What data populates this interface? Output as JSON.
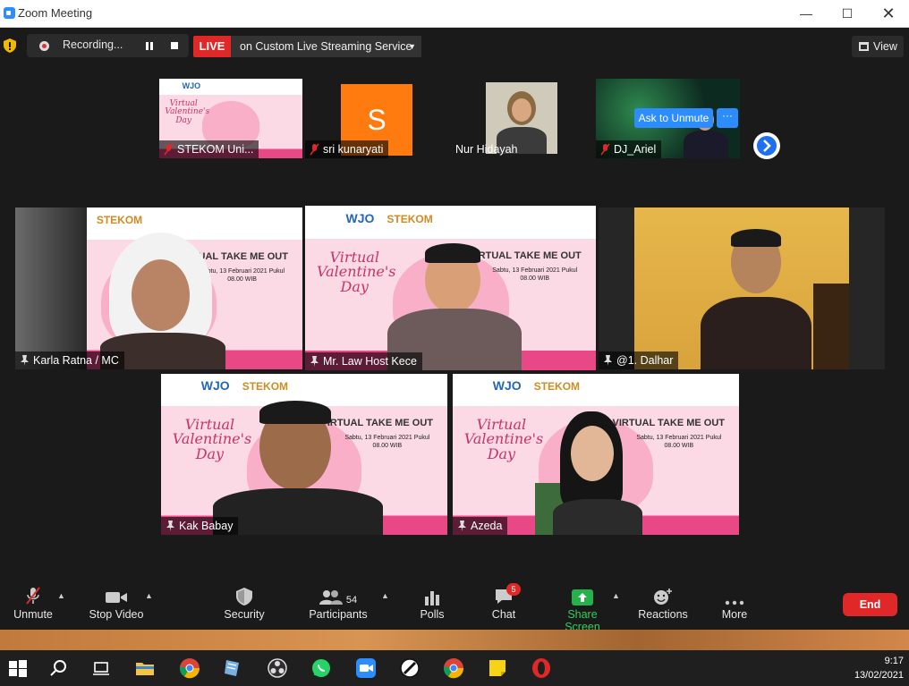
{
  "window": {
    "title": "Zoom Meeting"
  },
  "topbar": {
    "recording_label": "Recording...",
    "live_label": "LIVE",
    "live_service": "on Custom Live Streaming Service",
    "view_label": "View"
  },
  "poster": {
    "logo": "WJO",
    "logo2": "STEKOM",
    "script_title": "Virtual Valentine's Day",
    "headline": "VIRTUAL TAKE ME OUT",
    "info": "Sabtu, 13 Februari 2021 Pukul 08.00 WIB"
  },
  "thumbnails": [
    {
      "name": "STEKOM Uni..."
    },
    {
      "name": "sri kunaryati",
      "initial": "S"
    },
    {
      "name": "Nur Hidayah"
    },
    {
      "name": "DJ_Ariel"
    }
  ],
  "ask_to_unmute": "Ask to Unmute",
  "ask_more": "···",
  "gallery": [
    {
      "name": "Karla Ratna / MC"
    },
    {
      "name": "Mr. Law Host Kece"
    },
    {
      "name": "@1. Dalhar"
    },
    {
      "name": "Kak Babay"
    },
    {
      "name": "Azeda"
    }
  ],
  "toolbar": {
    "unmute": "Unmute",
    "stop_video": "Stop Video",
    "security": "Security",
    "participants": "Participants",
    "participants_count": "54",
    "polls": "Polls",
    "chat": "Chat",
    "chat_badge": "5",
    "share_screen": "Share Screen",
    "reactions": "Reactions",
    "more": "More",
    "end": "End"
  },
  "taskbar": {
    "time": "9:17",
    "date": "13/02/2021"
  },
  "colors": {
    "accent": "#2d8cff",
    "live": "#e02828",
    "share": "#23b34a",
    "highlight": "#e8e24a"
  }
}
